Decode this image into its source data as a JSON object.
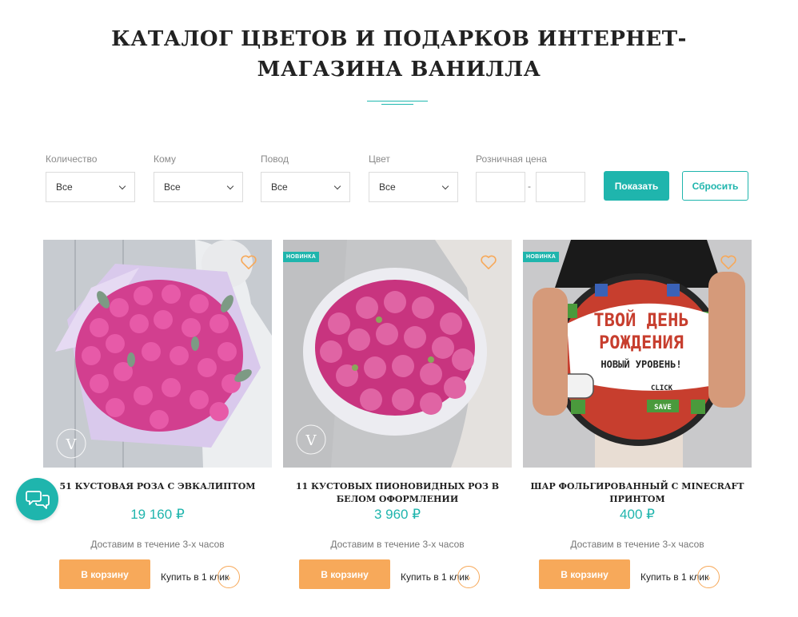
{
  "header": {
    "title": "КАТАЛОГ ЦВЕТОВ И ПОДАРКОВ ИНТЕРНЕТ-МАГАЗИНА ВАНИЛЛА"
  },
  "filters": {
    "quantity": {
      "label": "Количество",
      "value": "Все"
    },
    "recipient": {
      "label": "Кому",
      "value": "Все"
    },
    "occasion": {
      "label": "Повод",
      "value": "Все"
    },
    "color": {
      "label": "Цвет",
      "value": "Все"
    },
    "price": {
      "label": "Розничная цена",
      "from": "",
      "to": "",
      "separator": "-"
    },
    "show_label": "Показать",
    "reset_label": "Сбросить"
  },
  "products": [
    {
      "title": "51 КУСТОВАЯ РОЗА С ЭВКАЛИПТОМ",
      "price": "19 160 ₽",
      "delivery": "Доставим в течение 3-х часов",
      "badge": "",
      "cart_label": "В корзину",
      "one_click_label": "Купить в 1 клик"
    },
    {
      "title": "11 КУСТОВЫХ ПИОНОВИДНЫХ РОЗ В БЕЛОМ ОФОРМЛЕНИИ",
      "price": "3 960 ₽",
      "delivery": "Доставим в течение 3-х часов",
      "badge": "НОВИНКА",
      "cart_label": "В корзину",
      "one_click_label": "Купить в 1 клик"
    },
    {
      "title": "ШАР ФОЛЬГИРОВАННЫЙ С MINECRAFT ПРИНТОМ",
      "price": "400 ₽",
      "delivery": "Доставим в течение 3-х часов",
      "badge": "НОВИНКА",
      "cart_label": "В корзину",
      "one_click_label": "Купить в 1 клик"
    }
  ],
  "balloon_text": {
    "line1": "ТВОЙ ДЕНЬ",
    "line2": "РОЖДЕНИЯ",
    "line3": "НОВЫЙ УРОВЕНЬ!",
    "click": "CLICK",
    "save": "SAVE"
  },
  "icons": {
    "favorite": "heart-outline-icon",
    "chevron": "chevron-down-icon",
    "arrow": "chevron-right-icon",
    "chat": "chat-bubbles-icon",
    "brand_mark": "vanilla-logo-mark"
  },
  "colors": {
    "accent": "#1fb5ad",
    "cart_button": "#f7a95a",
    "title": "#222222"
  }
}
